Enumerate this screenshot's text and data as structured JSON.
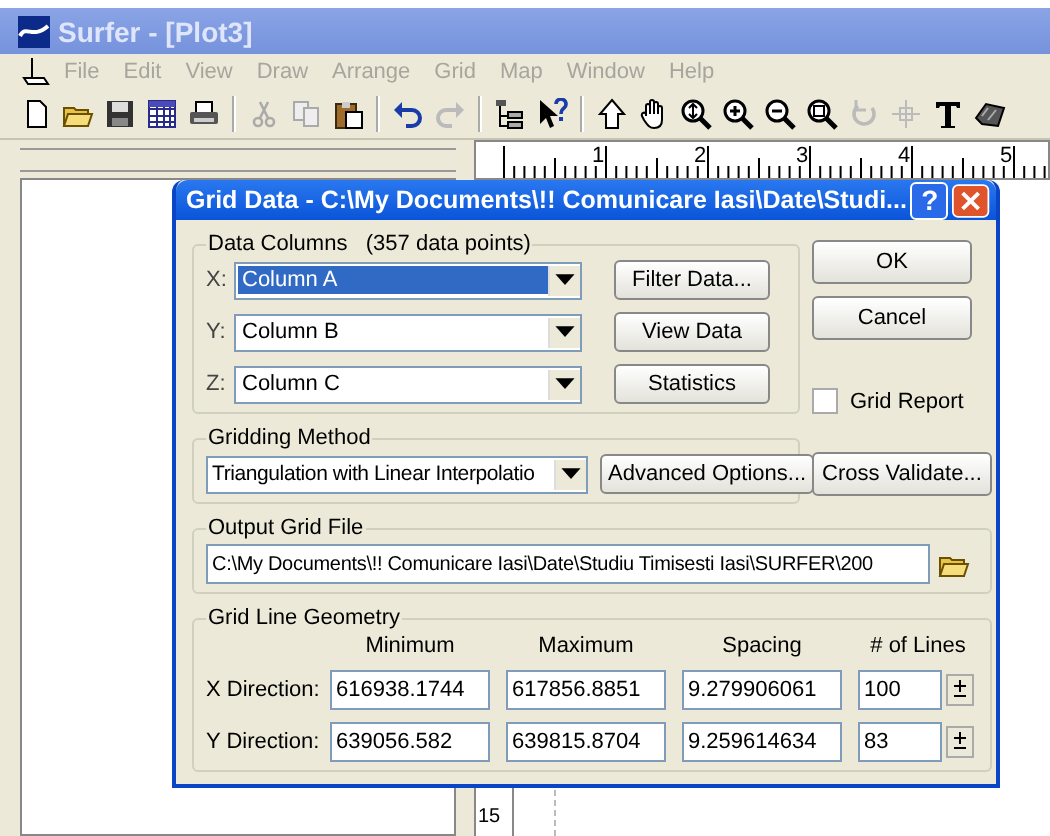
{
  "app_window": {
    "title": "Surfer - [Plot3]"
  },
  "menu": [
    {
      "label": "File",
      "disabled": true
    },
    {
      "label": "Edit",
      "disabled": true
    },
    {
      "label": "View",
      "disabled": true
    },
    {
      "label": "Draw",
      "disabled": true
    },
    {
      "label": "Arrange",
      "disabled": true
    },
    {
      "label": "Grid",
      "disabled": true
    },
    {
      "label": "Map",
      "disabled": true
    },
    {
      "label": "Window",
      "disabled": true
    },
    {
      "label": "Help",
      "disabled": true
    }
  ],
  "ruler": {
    "labels": [
      "1",
      "2",
      "3",
      "4",
      "5"
    ]
  },
  "vertical_ruler": {
    "labels": [
      "15"
    ]
  },
  "dialog": {
    "title": "Grid Data - C:\\My Documents\\!! Comunicare Iasi\\Date\\Studi...",
    "help_button": "?",
    "data_columns": {
      "title": "Data Columns",
      "count": "(357 data points)",
      "rows": [
        {
          "axis": "X:",
          "value": "Column A",
          "selected": true
        },
        {
          "axis": "Y:",
          "value": "Column B",
          "selected": false
        },
        {
          "axis": "Z:",
          "value": "Column C",
          "selected": false
        }
      ],
      "buttons": [
        "Filter Data...",
        "View Data",
        "Statistics"
      ]
    },
    "buttons": [
      "OK",
      "Cancel"
    ],
    "grid_report": {
      "label": "Grid Report",
      "checked": false
    },
    "gridding_method": {
      "title": "Gridding Method",
      "value": "Triangulation with Linear Interpolatio",
      "button": "Advanced Options..."
    },
    "cross_validate": "Cross Validate...",
    "output_grid_file": {
      "title": "Output Grid File",
      "value": "C:\\My Documents\\!! Comunicare Iasi\\Date\\Studiu Timisesti Iasi\\SURFER\\200"
    },
    "grid_line_geometry": {
      "title": "Grid Line Geometry",
      "columns": [
        "Minimum",
        "Maximum",
        "Spacing",
        "# of Lines"
      ],
      "rows": [
        {
          "label": "X Direction:",
          "minimum": "616938.1744",
          "maximum": "617856.8851",
          "spacing": "9.279906061",
          "lines": "100"
        },
        {
          "label": "Y Direction:",
          "minimum": "639056.582",
          "maximum": "639815.8704",
          "spacing": "9.259614634",
          "lines": "83"
        }
      ]
    }
  }
}
